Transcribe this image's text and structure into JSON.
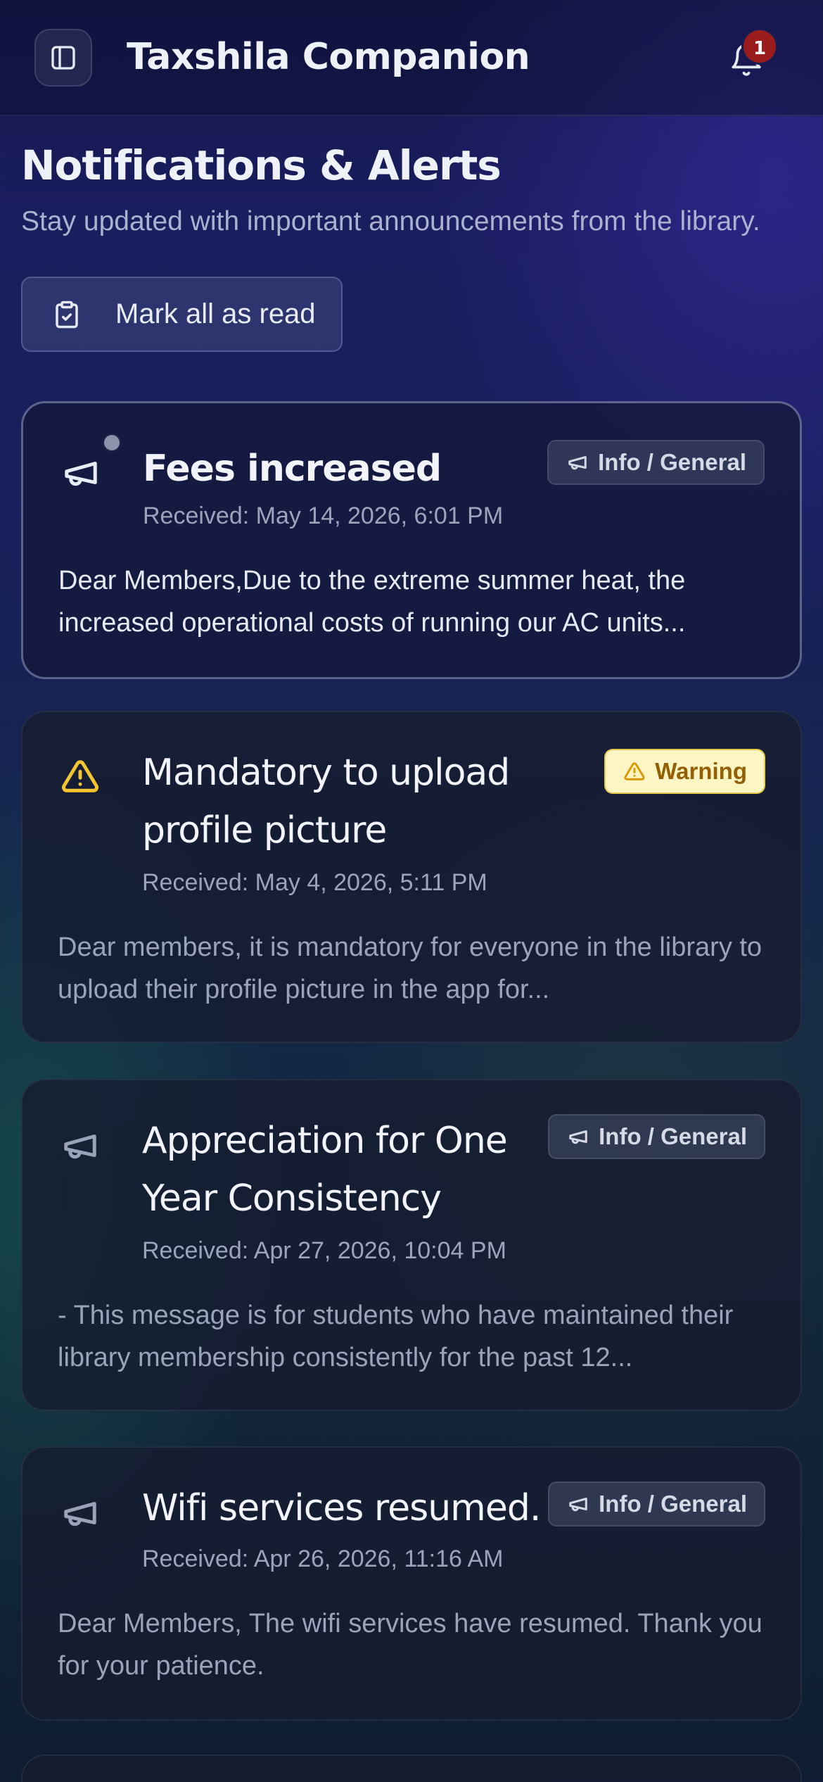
{
  "header": {
    "title": "Taxshila Companion",
    "notification_count": "1"
  },
  "page": {
    "title": "Notifications & Alerts",
    "subtitle": "Stay updated with important announcements from the library.",
    "mark_all_label": "Mark all as read"
  },
  "notifications": [
    {
      "title": "Fees increased",
      "date": "Received: May 14, 2026, 6:01 PM",
      "body": "Dear Members,Due to the extreme summer heat, the increased operational costs of running our AC units...",
      "badge": "Info / General",
      "type": "info",
      "unread": true
    },
    {
      "title": "Mandatory to upload profile picture",
      "date": "Received: May 4, 2026, 5:11 PM",
      "body": "Dear members, it is mandatory for everyone in the library to upload their profile picture in the app for...",
      "badge": "Warning",
      "type": "warning",
      "unread": false
    },
    {
      "title": "Appreciation for One Year Consistency",
      "date": "Received: Apr 27, 2026, 10:04 PM",
      "body": "- This message is for students who have maintained their library membership consistently for the past 12...",
      "badge": "Info / General",
      "type": "info",
      "unread": false
    },
    {
      "title": "Wifi services resumed.",
      "date": "Received: Apr 26, 2026, 11:16 AM",
      "body": "Dear Members, The wifi services have resumed. Thank you for your patience.",
      "badge": "Info / General",
      "type": "info",
      "unread": false
    }
  ],
  "colors": {
    "warning_icon": "#f3c52e",
    "badge_red": "#9b1c1c"
  },
  "icons": {
    "menu": "sidebar-toggle-icon",
    "bell": "bell-icon",
    "mark_read": "clipboard-check-icon",
    "info": "megaphone-icon",
    "warning": "warning-triangle-icon"
  }
}
